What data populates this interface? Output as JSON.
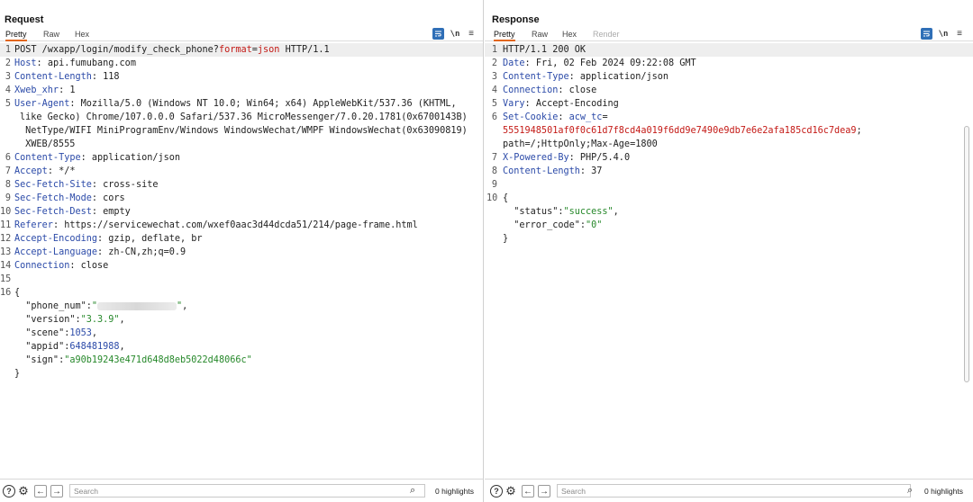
{
  "request": {
    "title": "Request",
    "tabs": [
      "Pretty",
      "Raw",
      "Hex"
    ],
    "search": {
      "placeholder": "Search"
    },
    "highlights": "0 highlights"
  },
  "response": {
    "title": "Response",
    "tabs": [
      "Pretty",
      "Raw",
      "Hex",
      "Render"
    ],
    "search": {
      "placeholder": "Search"
    },
    "highlights": "0 highlights"
  },
  "icons": {
    "wrap": "wrap-lines-icon",
    "newline": "\\n",
    "menu": "≡",
    "help": "?",
    "settings": "⚙",
    "back": "←",
    "forward": "→",
    "search": "⌕",
    "more": "···"
  },
  "colors": {
    "accent": "#2f6fb7",
    "header_key": "#2b4aa8",
    "cookie_value": "#c41a16",
    "string": "#26882a",
    "tab_underline": "#e2661d"
  }
}
